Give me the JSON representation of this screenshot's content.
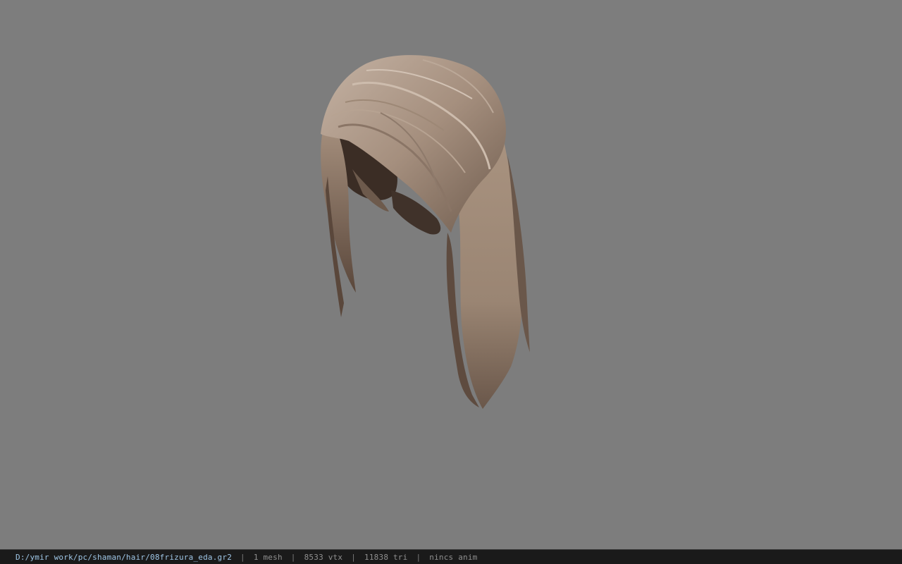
{
  "viewport": {
    "background": "#7d7d7d",
    "model": {
      "subject": "hair-mesh",
      "colors": {
        "light": "#b8a494",
        "mid": "#8f7a6a",
        "dark": "#4a3a30",
        "shadow": "#2e241e"
      }
    }
  },
  "status": {
    "file_path": "D:/ymir work/pc/shaman/hair/08frizura_eda.gr2",
    "mesh_count": "1 mesh",
    "vertex_count": "8533 vtx",
    "triangle_count": "11838 tri",
    "animation": "nincs anim",
    "separator": "|"
  }
}
